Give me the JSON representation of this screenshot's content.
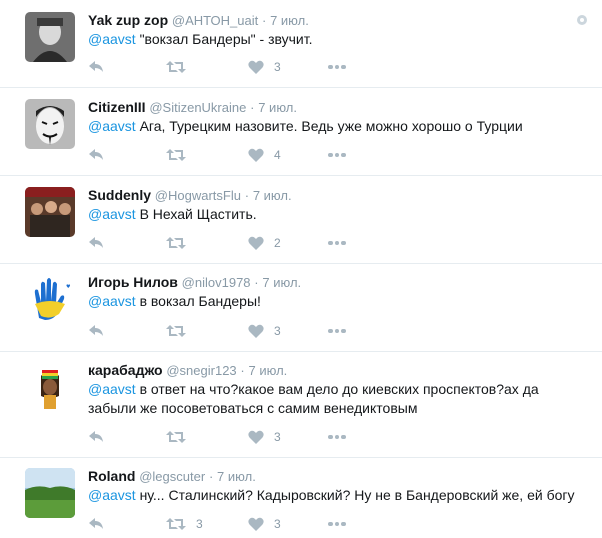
{
  "tweets": [
    {
      "name": "Yak zup zop",
      "handle": "@АНТОН_uait",
      "dot": "·",
      "time": "7 июл.",
      "mention": "@aavst",
      "text": " \"вокзал Бандеры\" - звучит.",
      "reply_count": "",
      "retweet_count": "",
      "like_count": "3"
    },
    {
      "name": "CitizenIII",
      "handle": "@SitizenUkraine",
      "dot": "·",
      "time": "7 июл.",
      "mention": "@aavst",
      "text": " Ага, Турецким назовите. Ведь уже можно хорошо о Турции",
      "reply_count": "",
      "retweet_count": "",
      "like_count": "4"
    },
    {
      "name": "Suddenly",
      "handle": "@HogwartsFlu",
      "dot": "·",
      "time": "7 июл.",
      "mention": "@aavst",
      "text": " В Нехай Щастить.",
      "reply_count": "",
      "retweet_count": "",
      "like_count": "2"
    },
    {
      "name": "Игорь Нилов",
      "handle": "@nilov1978",
      "dot": "·",
      "time": "7 июл.",
      "mention": "@aavst",
      "text": " в вокзал Бандеры!",
      "reply_count": "",
      "retweet_count": "",
      "like_count": "3"
    },
    {
      "name": "карабаджо",
      "handle": "@snegir123",
      "dot": "·",
      "time": "7 июл.",
      "mention": "@aavst",
      "text": " в ответ на что?какое вам дело до киевских проспектов?ах да забыли же посоветоваться с самим венедиктовым",
      "reply_count": "",
      "retweet_count": "",
      "like_count": "3"
    },
    {
      "name": "Roland",
      "handle": "@legscuter",
      "dot": "·",
      "time": "7 июл.",
      "mention": "@aavst",
      "text": " ну... Сталинский? Кадыровский? Ну не в Бандеровский же,  ей богу",
      "reply_count": "",
      "retweet_count": "3",
      "like_count": "3"
    }
  ],
  "icons": {
    "reply": "reply-icon",
    "retweet": "retweet-icon",
    "like": "heart-icon",
    "more": "more-icon",
    "settings": "settings-icon"
  },
  "colors": {
    "mention": "#1b95e0",
    "icon": "#aab8c2",
    "meta": "#8899a6",
    "border": "#e6ecf0"
  }
}
